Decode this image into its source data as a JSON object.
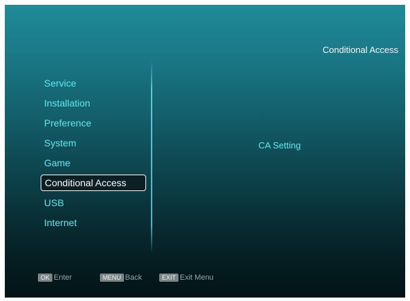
{
  "header": {
    "title": "Conditional Access"
  },
  "menu": {
    "items": [
      {
        "label": "Service"
      },
      {
        "label": "Installation"
      },
      {
        "label": "Preference"
      },
      {
        "label": "System"
      },
      {
        "label": "Game"
      },
      {
        "label": "Conditional Access",
        "selected": true
      },
      {
        "label": "USB"
      },
      {
        "label": "Internet"
      }
    ]
  },
  "content": {
    "items": [
      {
        "label": "CA Setting"
      }
    ]
  },
  "footer": {
    "hints": [
      {
        "key": "OK",
        "label": "Enter"
      },
      {
        "key": "MENU",
        "label": "Back"
      },
      {
        "key": "EXIT",
        "label": "Exit Menu"
      }
    ]
  },
  "colors": {
    "menu_text": "#63e6ec",
    "selected_text": "#ffffff",
    "selected_border": "#ffffff",
    "background_top": "#1f8a98",
    "background_bottom": "#041417"
  }
}
